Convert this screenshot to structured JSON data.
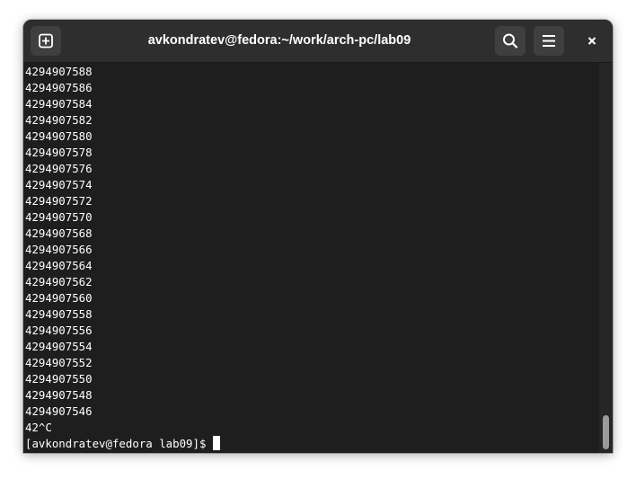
{
  "window": {
    "title": "avkondratev@fedora:~/work/arch-pc/lab09"
  },
  "toolbar": {
    "new_tab_icon": "new-tab-icon",
    "search_icon": "search-icon",
    "menu_icon": "hamburger-menu-icon",
    "close_icon": "close-icon"
  },
  "terminal": {
    "output_lines": [
      "4294907588",
      "4294907586",
      "4294907584",
      "4294907582",
      "4294907580",
      "4294907578",
      "4294907576",
      "4294907574",
      "4294907572",
      "4294907570",
      "4294907568",
      "4294907566",
      "4294907564",
      "4294907562",
      "4294907560",
      "4294907558",
      "4294907556",
      "4294907554",
      "4294907552",
      "4294907550",
      "4294907548",
      "4294907546",
      "42^C"
    ],
    "prompt": "[avkondratev@fedora lab09]$"
  },
  "colors": {
    "background": "#1e1e1e",
    "titlebar": "#2e2e2e",
    "text": "#ffffff"
  }
}
